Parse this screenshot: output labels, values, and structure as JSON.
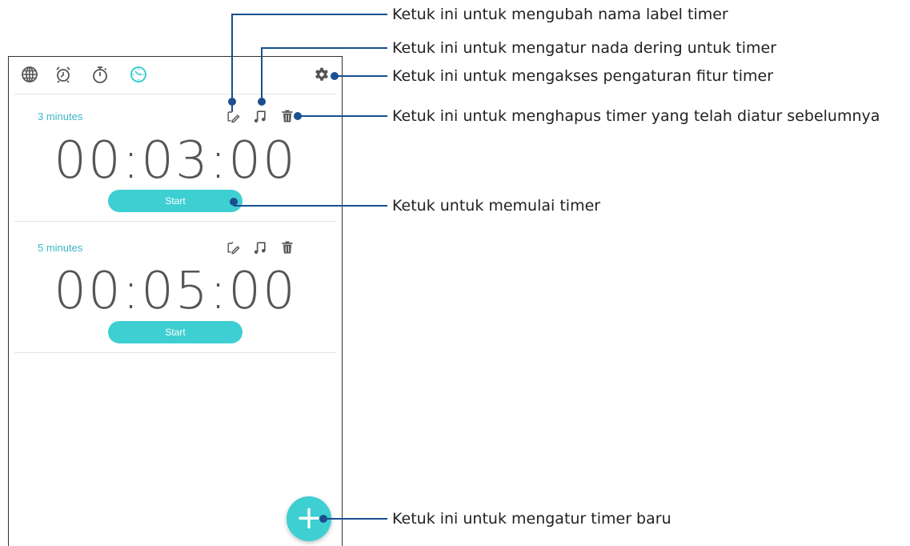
{
  "colors": {
    "accent": "#3ecfd2",
    "callout_line": "#1a4f91",
    "label_text": "#3ab6c8",
    "icon": "#555555"
  },
  "tabs": [
    {
      "icon": "world-clock-icon",
      "active": false
    },
    {
      "icon": "alarm-icon",
      "active": false
    },
    {
      "icon": "stopwatch-icon",
      "active": false
    },
    {
      "icon": "timer-icon",
      "active": true
    }
  ],
  "toolbar": {
    "settings_icon": "gear-icon"
  },
  "timers": [
    {
      "label": "3 minutes",
      "time": "00:03:00",
      "button": "Start"
    },
    {
      "label": "5 minutes",
      "time": "00:05:00",
      "button": "Start"
    }
  ],
  "fab": {
    "icon": "plus-icon",
    "symbol": "+"
  },
  "callouts": [
    "Ketuk ini untuk mengubah nama label timer",
    "Ketuk ini untuk mengatur nada dering untuk timer",
    "Ketuk ini untuk mengakses pengaturan fitur timer",
    "Ketuk ini untuk menghapus timer yang telah diatur sebelumnya",
    "Ketuk untuk memulai timer",
    "Ketuk ini untuk mengatur timer baru"
  ]
}
